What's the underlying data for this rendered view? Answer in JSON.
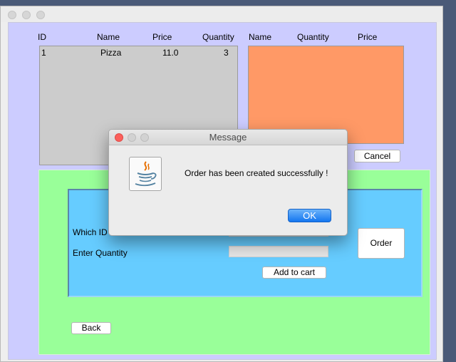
{
  "table": {
    "headers": [
      "ID",
      "Name",
      "Price",
      "Quantity"
    ],
    "rows": [
      {
        "id": "1",
        "name": "Pizza",
        "price": "11.0",
        "quantity": "3"
      }
    ]
  },
  "cart": {
    "headers": [
      "Name",
      "Quantity",
      "Price"
    ],
    "cancel_label": "Cancel"
  },
  "order_panel": {
    "which_id_label": "Which ID",
    "enter_quantity_label": "Enter  Quantity",
    "which_id_value": "",
    "quantity_value": "",
    "add_to_cart_label": "Add to cart",
    "order_label": "Order",
    "back_label": "Back"
  },
  "dialog": {
    "title": "Message",
    "message": "Order has been created successfully !",
    "ok_label": "OK",
    "icon": "java-icon"
  },
  "colors": {
    "content_bg": "#ccccff",
    "list_bg": "#cccccc",
    "cart_bg": "#ff9966",
    "green_panel": "#99ff99",
    "blue_panel": "#66ccff",
    "ok_button": "#1476f0"
  }
}
